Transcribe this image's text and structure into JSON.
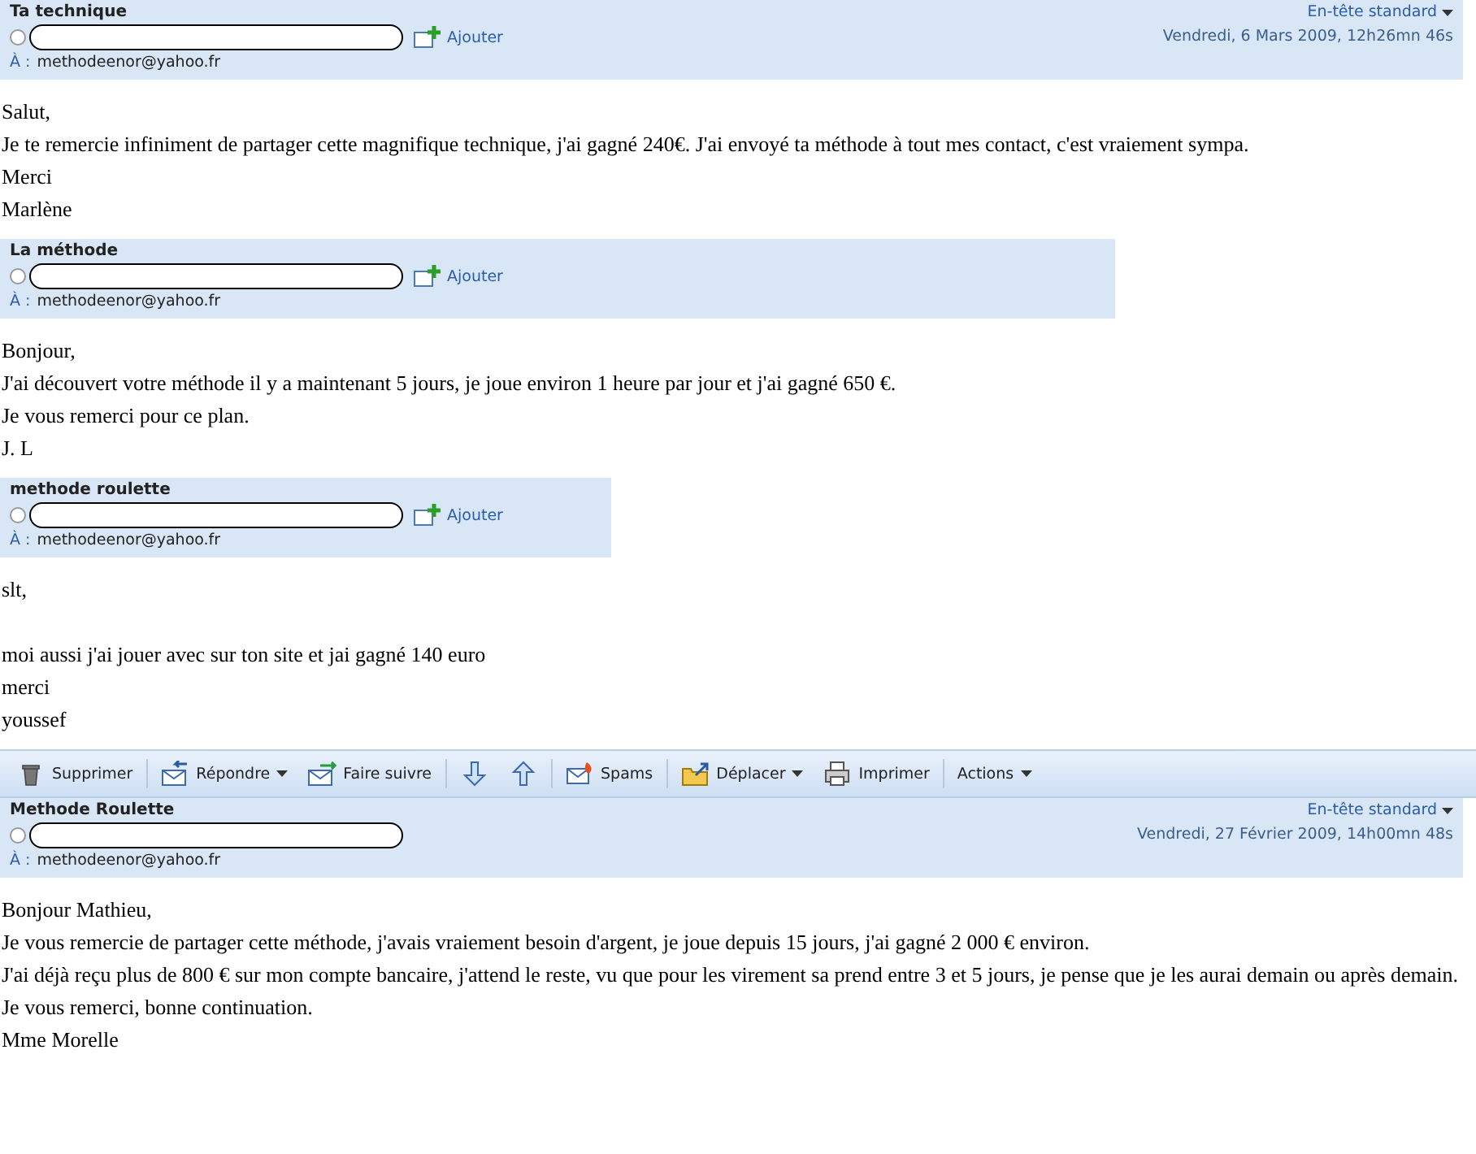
{
  "blocks": [
    {
      "kind": "message",
      "subject": "Ta technique",
      "add_label": "Ajouter",
      "to_label": "À :",
      "to": "methodeenor@yahoo.fr",
      "view_menu": "En-tête standard",
      "date": "Vendredi, 6 Mars 2009, 12h26mn 46s",
      "paragraphs": [
        [
          "Salut,",
          "Je te remercie infiniment de partager cette magnifique technique, j'ai gagné 240€. J'ai envoyé ta méthode à tout mes contact, c'est vraiement sympa.",
          "Merci",
          "Marlène"
        ]
      ]
    },
    {
      "kind": "message",
      "subject": "La méthode",
      "add_label": "Ajouter",
      "to_label": "À :",
      "to": "methodeenor@yahoo.fr",
      "paragraphs": [
        [
          "Bonjour,",
          "J'ai découvert votre méthode il y a maintenant 5 jours, je joue environ 1 heure par jour et j'ai gagné 650 €.",
          "Je vous remerci pour ce plan.",
          "J. L"
        ]
      ]
    },
    {
      "kind": "message",
      "subject": "methode roulette",
      "add_label": "Ajouter",
      "to_label": "À :",
      "to": "methodeenor@yahoo.fr",
      "paragraphs": [
        [
          "slt,"
        ],
        [
          "moi aussi j'ai jouer avec sur ton site et jai gagné 140 euro",
          "merci",
          "youssef"
        ]
      ]
    },
    {
      "kind": "toolbar",
      "items": [
        {
          "kind": "delete",
          "label": "Supprimer",
          "dropdown": false
        },
        {
          "kind": "reply",
          "label": "Répondre",
          "dropdown": true
        },
        {
          "kind": "forward",
          "label": "Faire suivre",
          "dropdown": false
        },
        {
          "kind": "next",
          "dropdown": false
        },
        {
          "kind": "previous",
          "dropdown": false
        },
        {
          "kind": "spam",
          "label": "Spams",
          "dropdown": false
        },
        {
          "kind": "move",
          "label": "Déplacer",
          "dropdown": true
        },
        {
          "kind": "print",
          "label": "Imprimer",
          "dropdown": false
        },
        {
          "kind": "actions",
          "label": "Actions",
          "dropdown": true
        }
      ]
    },
    {
      "kind": "message",
      "subject": "Methode Roulette",
      "to_label": "À :",
      "to": "methodeenor@yahoo.fr",
      "view_menu": "En-tête standard",
      "date": "Vendredi, 27 Février 2009, 14h00mn 48s",
      "paragraphs": [
        [
          "Bonjour Mathieu,",
          "Je vous remercie de partager cette méthode, j'avais vraiement besoin d'argent, je joue depuis 15 jours, j'ai gagné 2 000 € environ.",
          "J'ai déjà reçu plus de 800 € sur mon compte bancaire, j'attend le reste, vu que pour les virement sa prend entre 3 et 5 jours, je pense que je les aurai demain ou après demain.",
          "Je vous remerci, bonne continuation.",
          "Mme Morelle"
        ]
      ]
    }
  ]
}
